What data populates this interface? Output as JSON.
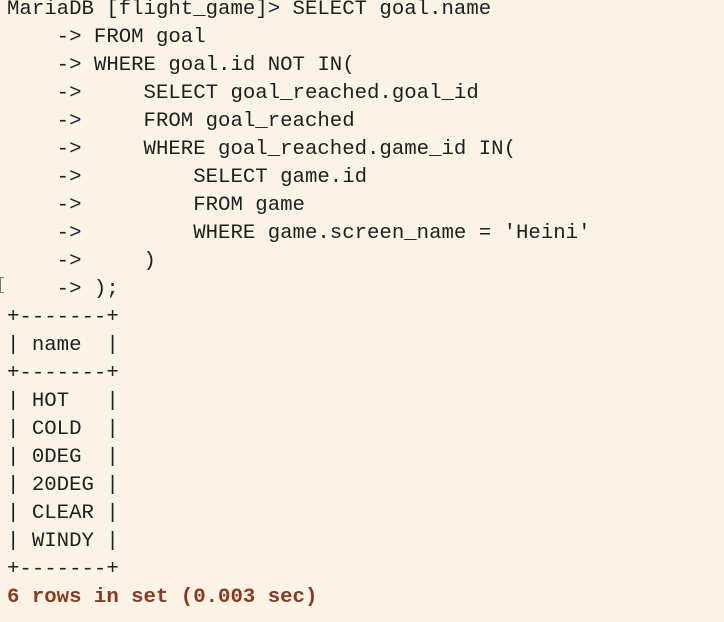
{
  "terminal": {
    "lines": [
      "MariaDB [flight_game]> SELECT goal.name",
      "    -> FROM goal",
      "    -> WHERE goal.id NOT IN(",
      "    ->     SELECT goal_reached.goal_id",
      "    ->     FROM goal_reached",
      "    ->     WHERE goal_reached.game_id IN(",
      "    ->         SELECT game.id",
      "    ->         FROM game",
      "    ->         WHERE game.screen_name = 'Heini'",
      "    ->     )",
      "    -> );",
      "+-------+",
      "| name  |",
      "+-------+",
      "| HOT   |",
      "| COLD  |",
      "| 0DEG  |",
      "| 20DEG |",
      "| CLEAR |",
      "| WINDY |",
      "+-------+"
    ],
    "status": "6 rows in set (0.003 sec)"
  }
}
